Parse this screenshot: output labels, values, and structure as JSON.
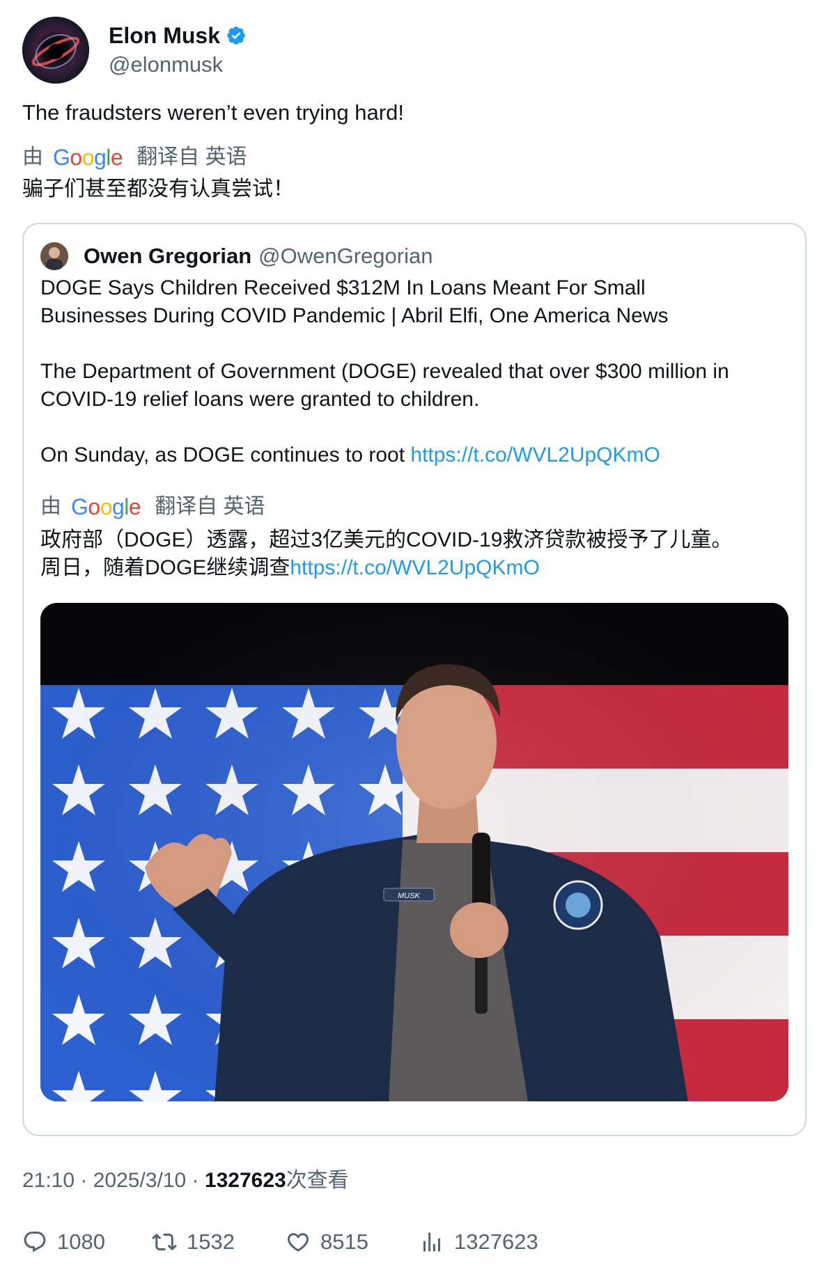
{
  "author": {
    "display_name": "Elon Musk",
    "handle": "@elonmusk",
    "verified": true
  },
  "tweet": {
    "text": "The fraudsters weren’t even trying hard!",
    "translation": {
      "by": "由",
      "provider": "Google",
      "label": "翻译自 英语",
      "text": "骗子们甚至都没有认真尝试！"
    }
  },
  "quote": {
    "display_name": "Owen Gregorian",
    "handle": "@OwenGregorian",
    "line1": "DOGE Says Children Received $312M In Loans Meant For Small",
    "line2": "Businesses During COVID Pandemic | Abril Elfi, One America News",
    "para2_line1": "The Department of Government (DOGE) revealed that over $300 million in",
    "para2_line2": "COVID-19 relief loans were granted to children.",
    "para3_text": "On Sunday, as DOGE continues to root ",
    "link": "https://t.co/WVL2UpQKmO",
    "translation": {
      "by": "由",
      "provider": "Google",
      "label": "翻译自 英语",
      "line1": "政府部（DOGE）透露，超过3亿美元的COVID-19救济贷款被授予了儿童。",
      "line2_text": "周日，随着DOGE继续调查",
      "line2_link": "https://t.co/WVL2UpQKmO"
    },
    "media_jacket_tag": "MUSK"
  },
  "meta": {
    "time": "21:10",
    "sep1": " · ",
    "date": "2025/3/10",
    "sep2": " · ",
    "views": "1327623",
    "views_suffix": "次查看"
  },
  "actions": {
    "replies": "1080",
    "reposts": "1532",
    "likes": "8515",
    "views": "1327623"
  },
  "colors": {
    "link": "#1d9bf0",
    "verified": "#1d9bf0",
    "secondary_text": "#536471",
    "primary_text": "#0f1419",
    "border": "#cfd9de"
  },
  "icons": [
    "verified-badge-icon",
    "reply-icon",
    "repost-icon",
    "like-icon",
    "views-icon"
  ]
}
